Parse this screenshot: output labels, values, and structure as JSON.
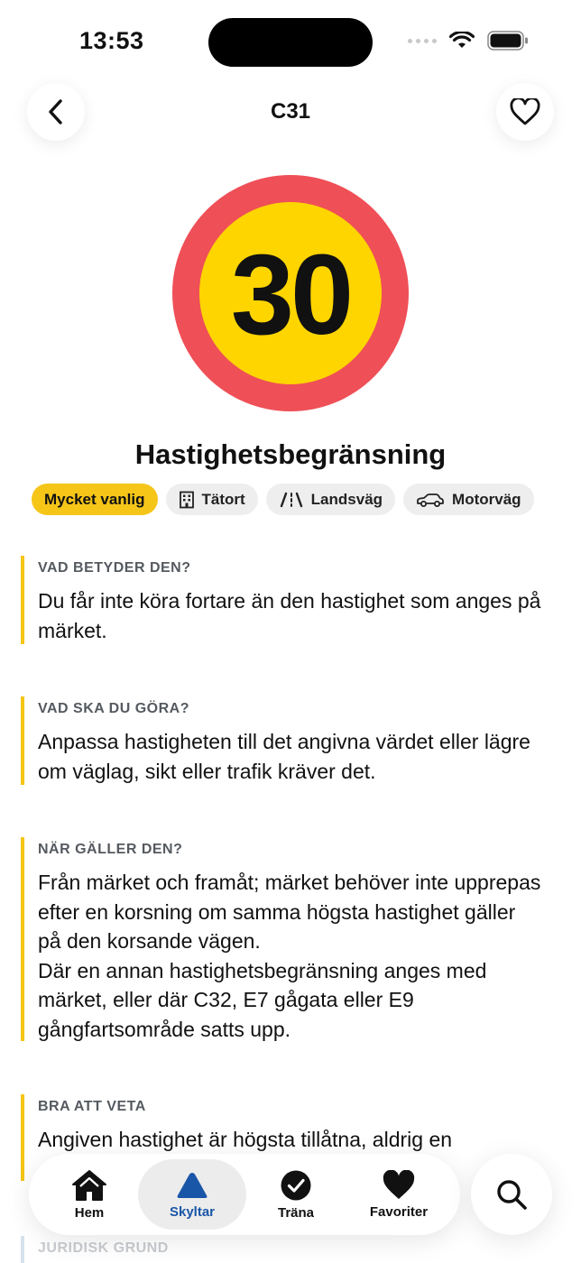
{
  "status_bar": {
    "time": "13:53"
  },
  "header": {
    "title": "C31"
  },
  "sign": {
    "number_text": "30",
    "colors": {
      "ring": "#ef4f57",
      "fill": "#ffd500",
      "digits": "#111111"
    }
  },
  "sign_name": "Hastighetsbegränsning",
  "tags": [
    {
      "label": "Mycket vanlig",
      "icon": ""
    },
    {
      "label": "Tätort",
      "icon": "building-icon"
    },
    {
      "label": "Landsväg",
      "icon": "road-icon"
    },
    {
      "label": "Motorväg",
      "icon": "car-icon"
    }
  ],
  "sections": [
    {
      "label": "VAD BETYDER DEN?",
      "text": "Du får inte köra fortare än den hastighet som anges på märket."
    },
    {
      "label": "VAD SKA DU GÖRA?",
      "text": "Anpassa hastigheten till det angivna värdet eller lägre om väglag, sikt eller trafik kräver det."
    },
    {
      "label": "NÄR GÄLLER DEN?",
      "text": "Från märket och framåt; märket behöver inte upprepas efter en korsning om samma högsta hastighet gäller på den korsande vägen.\nDär en annan hastighetsbegränsning anges med märket, eller där C32, E7 gågata eller E9 gångfartsområde satts upp."
    },
    {
      "label": "BRA ATT VETA",
      "text": "Angiven hastighet är högsta tillåtna, aldrig en"
    },
    {
      "label": "JURIDISK GRUND",
      "text": ""
    }
  ],
  "tabbar": {
    "items": [
      {
        "label": "Hem",
        "icon": "home-icon"
      },
      {
        "label": "Skyltar",
        "icon": "triangle-sign-icon",
        "active": true
      },
      {
        "label": "Träna",
        "icon": "check-circle-icon"
      },
      {
        "label": "Favoriter",
        "icon": "heart-icon"
      }
    ],
    "search_icon": "search-icon",
    "accent": "#1a56a8"
  }
}
